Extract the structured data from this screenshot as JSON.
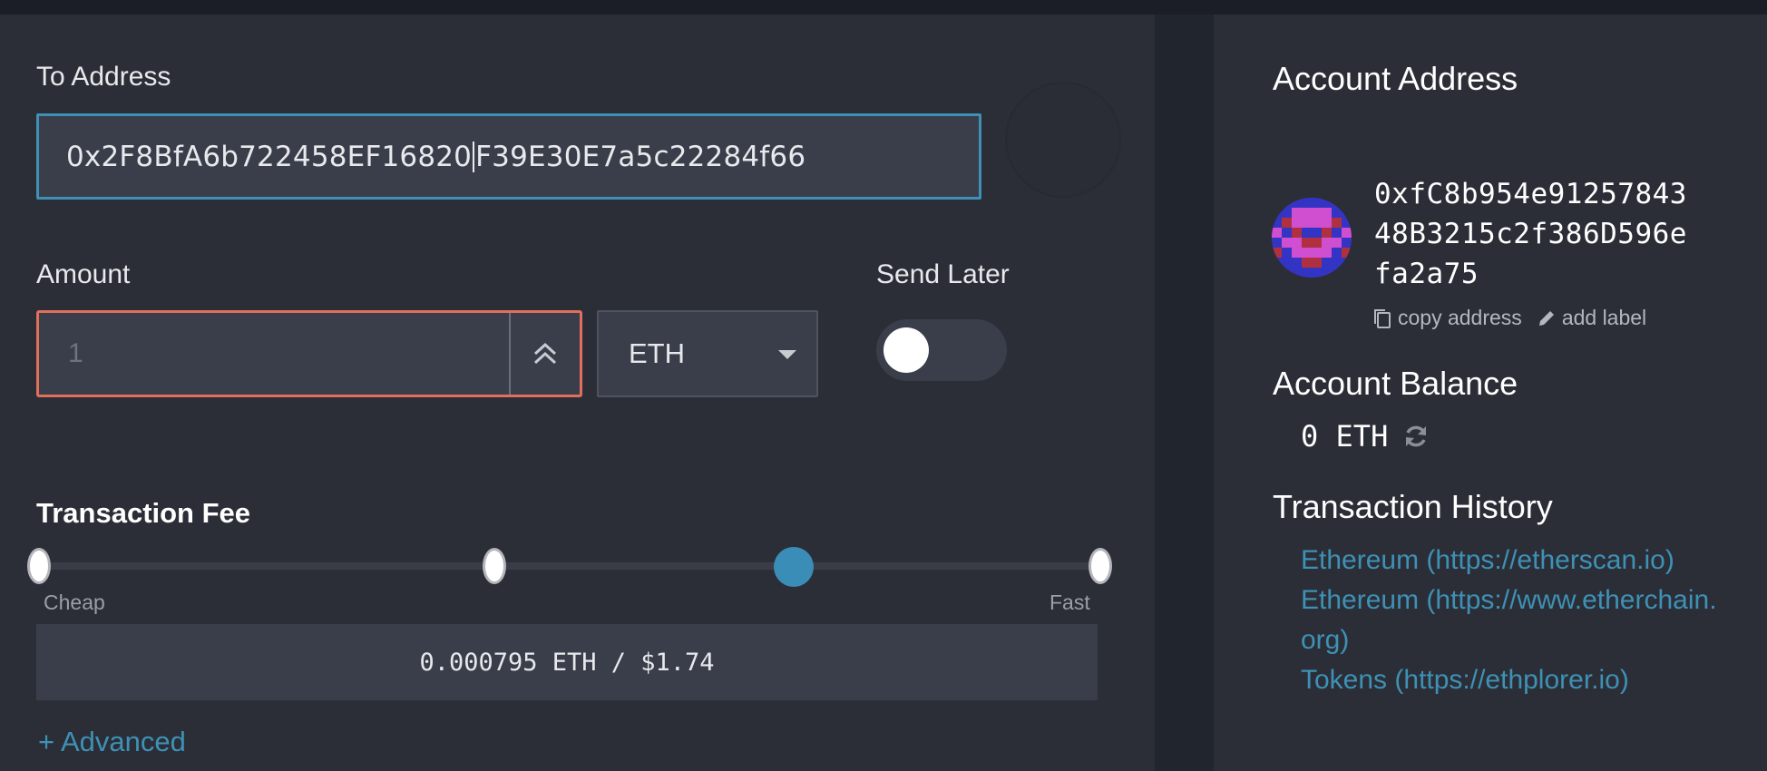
{
  "send_form": {
    "to_address_label": "To Address",
    "to_address_value_before": "0x2F8BfA6b722458EF16820",
    "to_address_value_after": "F39E30E7a5c22284f66",
    "amount_label": "Amount",
    "amount_placeholder": "1",
    "currency": "ETH",
    "send_later_label": "Send Later",
    "send_later_enabled": false
  },
  "fee": {
    "title": "Transaction Fee",
    "cheap_label": "Cheap",
    "fast_label": "Fast",
    "slider_level": 0.67,
    "summary": "0.000795 ETH / $1.74",
    "advanced_label": "+ Advanced"
  },
  "account": {
    "address_title": "Account Address",
    "address": "0xfC8b954e9125784348B3215c2f386D596efa2a75",
    "copy_label": "copy address",
    "label_label": "add label",
    "balance_title": "Account Balance",
    "balance": "0 ETH",
    "history_title": "Transaction History",
    "history_links": [
      "Ethereum (https://etherscan.io)",
      "Ethereum (https://www.etherchain.org)",
      "Tokens (https://ethplorer.io)"
    ]
  },
  "colors": {
    "accent": "#3e91b5",
    "error_border": "#e06f5c",
    "panel_bg": "#2b2e37",
    "page_bg": "#21252d"
  },
  "icons": [
    "chevron-double-up-icon",
    "chevron-down-icon",
    "copy-icon",
    "pencil-icon",
    "refresh-icon"
  ]
}
